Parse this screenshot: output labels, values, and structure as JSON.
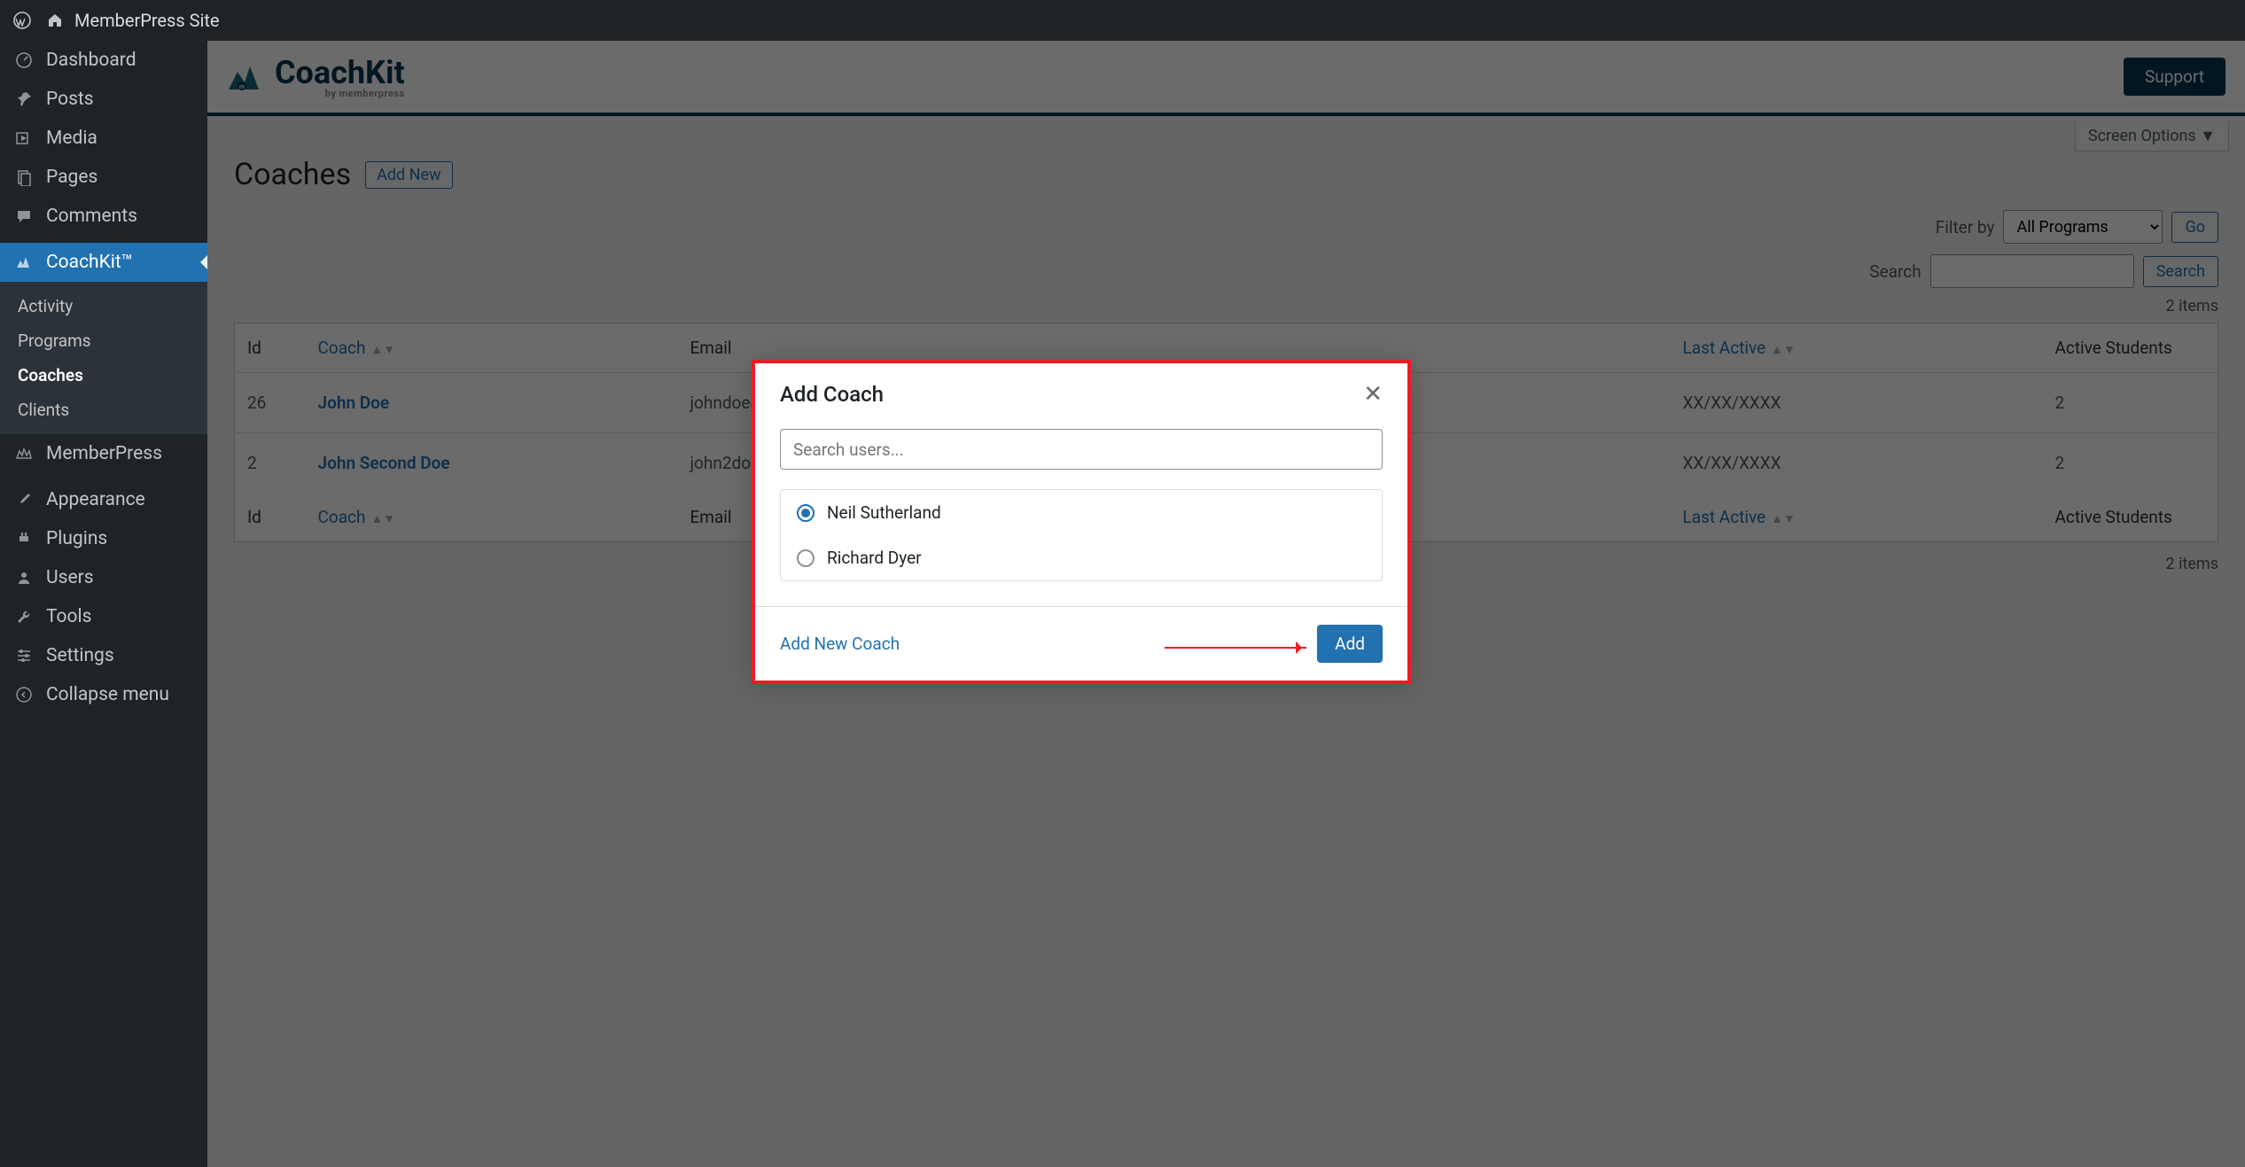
{
  "adminbar": {
    "site_name": "MemberPress Site"
  },
  "sidebar": {
    "items": {
      "dashboard": "Dashboard",
      "posts": "Posts",
      "media": "Media",
      "pages": "Pages",
      "comments": "Comments",
      "coachkit": "CoachKit™",
      "memberpress": "MemberPress",
      "appearance": "Appearance",
      "plugins": "Plugins",
      "users": "Users",
      "tools": "Tools",
      "settings": "Settings",
      "collapse": "Collapse menu"
    },
    "submenu": {
      "activity": "Activity",
      "programs": "Programs",
      "coaches": "Coaches",
      "clients": "Clients"
    }
  },
  "brand": {
    "name": "CoachKit",
    "sub": "by memberpress",
    "support": "Support"
  },
  "screen_options": "Screen Options ▼",
  "page": {
    "title": "Coaches",
    "addnew": "Add New"
  },
  "filters": {
    "filterby_label": "Filter by",
    "filterby_value": "All Programs",
    "go": "Go",
    "search_label": "Search",
    "search_btn": "Search"
  },
  "items_count": "2 items",
  "table": {
    "headers": {
      "id": "Id",
      "coach": "Coach",
      "email": "Email",
      "lastactive": "Last Active",
      "activestudents": "Active Students"
    },
    "rows": [
      {
        "id": "26",
        "coach": "John Doe",
        "email": "johndoe@m",
        "lastactive": "XX/XX/XXXX",
        "activestudents": "2"
      },
      {
        "id": "2",
        "coach": "John Second Doe",
        "email": "john2doe@",
        "lastactive": "XX/XX/XXXX",
        "activestudents": "2"
      }
    ]
  },
  "modal": {
    "title": "Add Coach",
    "search_placeholder": "Search users...",
    "users": [
      {
        "name": "Neil Sutherland",
        "selected": true
      },
      {
        "name": "Richard Dyer",
        "selected": false
      }
    ],
    "add_new_coach": "Add New Coach",
    "add": "Add"
  }
}
